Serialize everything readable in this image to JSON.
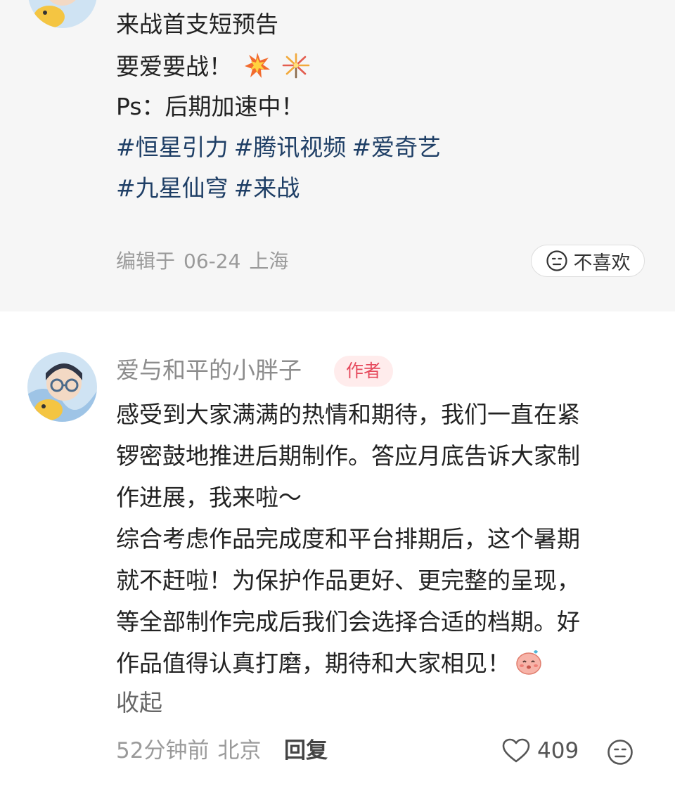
{
  "post": {
    "lines": [
      "来战首支短预告",
      "要爱要战！",
      "Ps：后期加速中！"
    ],
    "emoji_names": [
      "collision-emoji",
      "sparkler-emoji"
    ],
    "tags_row1": [
      "#恒星引力",
      "#腾讯视频",
      "#爱奇艺"
    ],
    "tags_row2": [
      "#九星仙穹",
      "#来战"
    ],
    "meta": {
      "edited": "编辑于",
      "date": "06-24",
      "location": "上海"
    },
    "dislike_label": "不喜欢"
  },
  "comment": {
    "author": "爱与和平的小胖子",
    "badge": "作者",
    "lines": [
      "感受到大家满满的热情和期待，我们一直在紧",
      "锣密鼓地推进后期制作。答应月底告诉大家制",
      "作进展，我来啦～",
      "综合考虑作品完成度和平台排期后，这个暑期",
      "就不赶啦！为保护作品更好、更完整的呈现，",
      "等全部制作完成后我们会选择合适的档期。好",
      "作品值得认真打磨，期待和大家相见！"
    ],
    "collapse_label": "收起",
    "time": "52分钟前",
    "location": "北京",
    "reply_label": "回复",
    "likes": "409"
  },
  "colors": {
    "tag": "#1f3f66",
    "badge_bg": "#ffecec",
    "badge_text": "#e64a5d",
    "post_bg": "#f6f6f6"
  }
}
